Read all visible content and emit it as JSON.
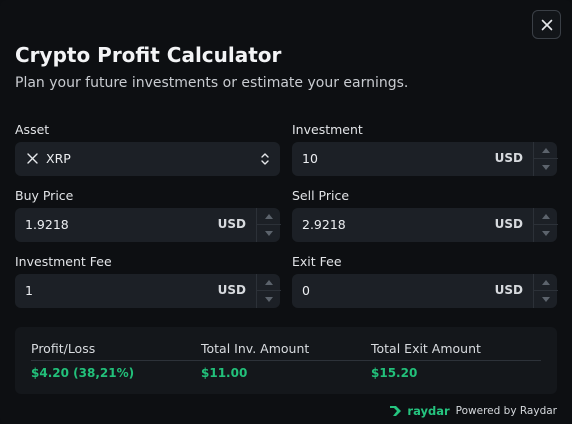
{
  "header": {
    "title": "Crypto Profit Calculator",
    "subtitle": "Plan your future investments or estimate your earnings."
  },
  "close_icon": "close-icon",
  "form": {
    "asset": {
      "label": "Asset",
      "value": "XRP",
      "icon": "xrp-icon"
    },
    "investment": {
      "label": "Investment",
      "value": "10",
      "unit": "USD"
    },
    "buy_price": {
      "label": "Buy Price",
      "value": "1.9218",
      "unit": "USD"
    },
    "sell_price": {
      "label": "Sell Price",
      "value": "2.9218",
      "unit": "USD"
    },
    "investment_fee": {
      "label": "Investment Fee",
      "value": "1",
      "unit": "USD"
    },
    "exit_fee": {
      "label": "Exit Fee",
      "value": "0",
      "unit": "USD"
    }
  },
  "results": {
    "profit_loss": {
      "label": "Profit/Loss",
      "value": "$4.20 (38,21%)"
    },
    "total_inv": {
      "label": "Total Inv. Amount",
      "value": "$11.00"
    },
    "total_exit": {
      "label": "Total Exit Amount",
      "value": "$15.20"
    }
  },
  "footer": {
    "brand": "raydar",
    "powered": "Powered by Raydar"
  },
  "colors": {
    "accent": "#22c07a",
    "background": "#0d0f12",
    "field": "#1c2026"
  }
}
